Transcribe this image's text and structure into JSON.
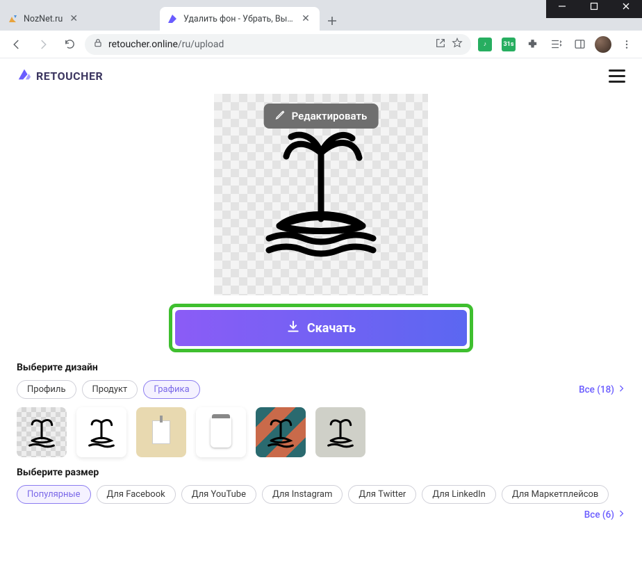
{
  "browser": {
    "tabs": [
      {
        "title": "NozNet.ru",
        "active": false
      },
      {
        "title": "Удалить фон - Убрать, Вырезать",
        "active": true
      }
    ],
    "url_domain": "retoucher.online",
    "url_path": "/ru/upload",
    "ext_badge": "31s"
  },
  "header": {
    "brand": "RETOUCHER"
  },
  "canvas": {
    "edit_label": "Редактировать"
  },
  "download": {
    "label": "Скачать"
  },
  "design": {
    "title": "Выберите дизайн",
    "chips": [
      "Профиль",
      "Продукт",
      "Графика"
    ],
    "active_index": 2,
    "more": "Все (18)"
  },
  "size": {
    "title": "Выберите размер",
    "chips": [
      "Популярные",
      "Для Facebook",
      "Для YouTube",
      "Для Instagram",
      "Для Twitter",
      "Для LinkedIn",
      "Для Маркетплейсов"
    ],
    "active_index": 0,
    "more": "Все (6)"
  }
}
